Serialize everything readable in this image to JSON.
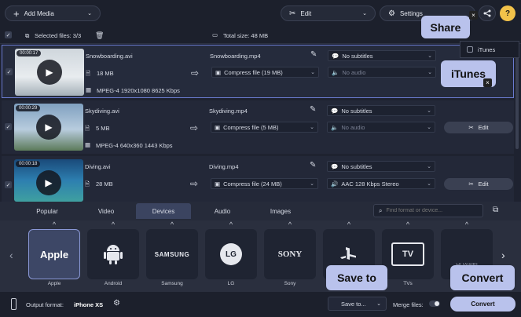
{
  "toolbar": {
    "add_media": "Add Media",
    "edit": "Edit",
    "settings": "Settings"
  },
  "selection": {
    "selected_files": "Selected files: 3/3",
    "total_size": "Total size: 48 MB"
  },
  "files": [
    {
      "duration": "00:00:17",
      "name": "Snowboarding.avi",
      "size": "18 MB",
      "codec": "MPEG-4 1920x1080 8625 Kbps",
      "output_name": "Snowboarding.mp4",
      "compress": "Compress file (19 MB)",
      "subtitles": "No subtitles",
      "audio": "No audio",
      "edit": "Edit"
    },
    {
      "duration": "00:00:29",
      "name": "Skydiving.avi",
      "size": "5 MB",
      "codec": "MPEG-4 640x360 1443 Kbps",
      "output_name": "Skydiving.mp4",
      "compress": "Compress file (5 MB)",
      "subtitles": "No subtitles",
      "audio": "No audio",
      "edit": "Edit"
    },
    {
      "duration": "00:00:18",
      "name": "Diving.avi",
      "size": "28 MB",
      "codec": "",
      "output_name": "Diving.mp4",
      "compress": "Compress file (24 MB)",
      "subtitles": "No subtitles",
      "audio": "AAC 128 Kbps Stereo",
      "edit": "Edit"
    }
  ],
  "format_tabs": [
    "Popular",
    "Video",
    "Devices",
    "Audio",
    "Images"
  ],
  "active_tab": "Devices",
  "search": {
    "placeholder": "Find format or device..."
  },
  "devices": [
    {
      "label": "Apple",
      "logo": "Apple"
    },
    {
      "label": "Android",
      "logo": ""
    },
    {
      "label": "Samsung",
      "logo": "SAMSUNG"
    },
    {
      "label": "LG",
      "logo": "LG"
    },
    {
      "label": "Sony",
      "logo": "SONY"
    },
    {
      "label": "",
      "logo": ""
    },
    {
      "label": "TVs",
      "logo": "TV"
    },
    {
      "label": "",
      "logo": "HUAWEI"
    }
  ],
  "bottom": {
    "output_format_label": "Output format:",
    "output_format_value": "iPhone XS",
    "save_to": "Save to...",
    "merge_files": "Merge files:",
    "convert": "Convert"
  },
  "share_popup": {
    "itunes": "iTunes"
  },
  "callouts": {
    "share": "Share",
    "itunes": "iTunes",
    "save_to": "Save to",
    "convert": "Convert"
  },
  "colors": {
    "accent": "#6a7bd0",
    "convert_button": "#b9c2ec",
    "background": "#1e2230"
  }
}
